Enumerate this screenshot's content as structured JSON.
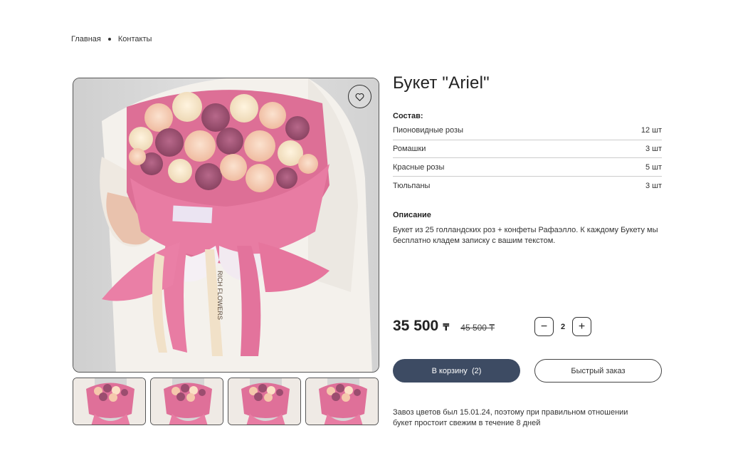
{
  "breadcrumb": {
    "home": "Главная",
    "current": "Контакты"
  },
  "product": {
    "title": "Букет \"Ariel\"",
    "composition_label": "Состав:",
    "composition": [
      {
        "name": "Пионовидные розы",
        "qty": "12 шт"
      },
      {
        "name": "Ромашки",
        "qty": "3 шт"
      },
      {
        "name": "Красные розы",
        "qty": "5 шт"
      },
      {
        "name": "Тюльпаны",
        "qty": "3 шт"
      }
    ],
    "description_label": "Описание",
    "description": "Букет из 25 голландских роз + конфеты Рафаэлло. К каждому Букету мы бесплатно кладем записку с вашим текстом.",
    "price": "35 500",
    "currency": "₸",
    "old_price": "45 500 ₸",
    "quantity": "2",
    "note": "Завоз цветов был 15.01.24, поэтому при правильном отношении букет простоит свежим в течение 8 дней",
    "ribbon_text": "RICH FLOWERS"
  },
  "actions": {
    "cart_label": "В корзину",
    "cart_count": "(2)",
    "fast_order_label": "Быстрый заказ",
    "minus": "−",
    "plus": "+"
  },
  "icons": {
    "favorite": "heart-icon"
  },
  "colors": {
    "primary": "#3d4b63",
    "wrap_pink": "#e5709a"
  },
  "thumbnails": 4
}
